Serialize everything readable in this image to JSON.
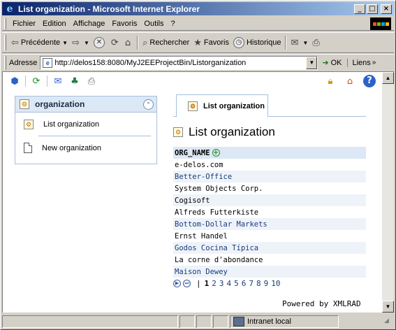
{
  "window": {
    "title": "List organization - Microsoft Internet Explorer",
    "controls": {
      "minimize": "_",
      "maximize": "□",
      "close": "×"
    }
  },
  "menu": {
    "items": [
      {
        "label": "Fichier"
      },
      {
        "label": "Edition"
      },
      {
        "label": "Affichage"
      },
      {
        "label": "Favoris"
      },
      {
        "label": "Outils"
      },
      {
        "label": "?"
      }
    ]
  },
  "toolbar": {
    "back_label": "Précédente",
    "search_label": "Rechercher",
    "favorites_label": "Favoris",
    "history_label": "Historique"
  },
  "address": {
    "label": "Adresse",
    "url": "http://delos158:8080/MyJ2EEProjectBin/Listorganization",
    "go_label": "OK",
    "links_label": "Liens"
  },
  "sidebar": {
    "title": "organization",
    "items": [
      {
        "label": "List organization"
      },
      {
        "label": "New organization"
      }
    ]
  },
  "tabs": [
    {
      "label": "List organization",
      "active": true
    }
  ],
  "main": {
    "heading": "List organization",
    "column_header": "ORG_NAME",
    "rows": [
      "e-delos.com",
      "Better-Office",
      "System Objects Corp.",
      "Cogisoft",
      "Alfreds Futterkiste",
      "Bottom-Dollar Markets",
      "Ernst Handel",
      "Godos Cocina Típica",
      "La corne d'abondance",
      "Maison Dewey"
    ]
  },
  "pager": {
    "separator": "|",
    "pages": [
      "1",
      "2",
      "3",
      "4",
      "5",
      "6",
      "7",
      "8",
      "9",
      "10"
    ],
    "current": "1"
  },
  "footer": {
    "powered": "Powered by XMLRAD"
  },
  "status": {
    "zone": "Intranet local"
  },
  "colors": {
    "titlebar_start": "#0a246a",
    "titlebar_end": "#a6caf0",
    "panel_header": "#dce8f5",
    "link": "#1a3b7a"
  }
}
